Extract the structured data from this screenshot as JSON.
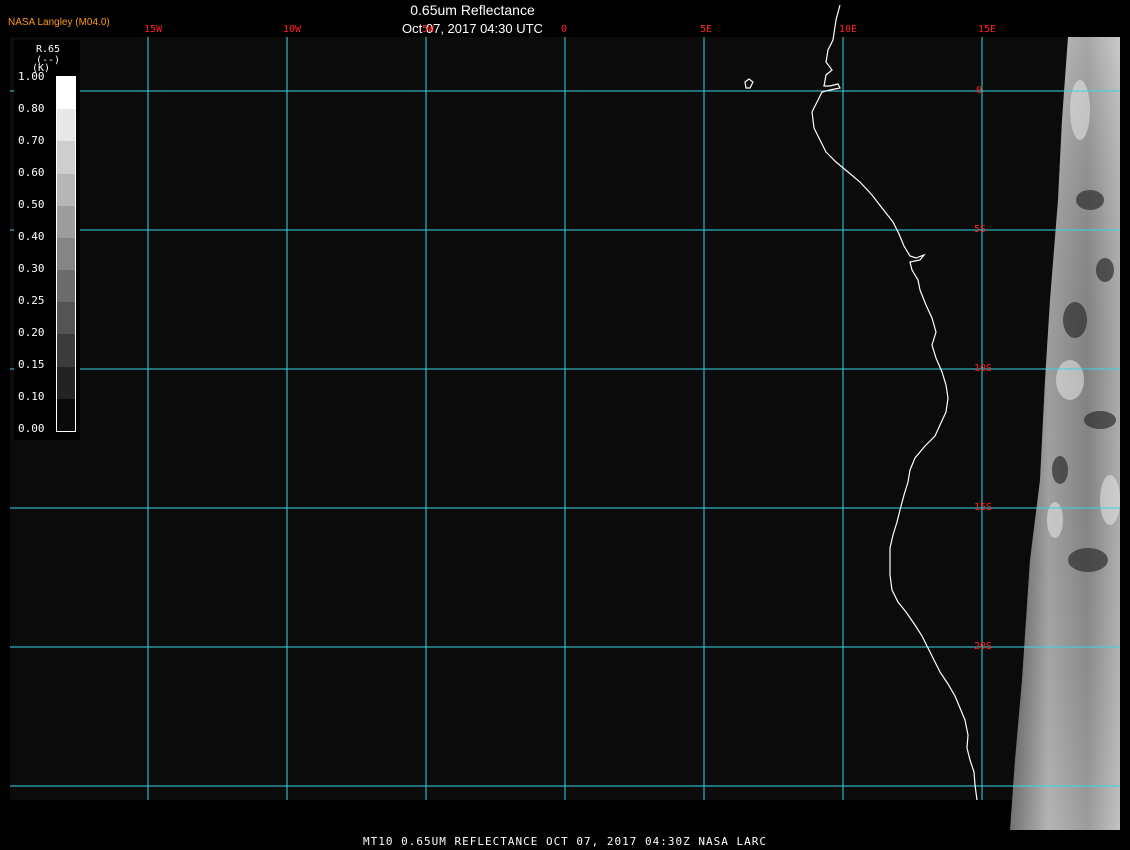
{
  "header": {
    "logo": "NASA Langley (M04.0)",
    "title": "0.65um Reflectance",
    "subtitle": "Oct 07, 2017 04:30 UTC"
  },
  "map": {
    "lon_labels": [
      "15W",
      "10W",
      "5W",
      "0",
      "5E",
      "10E",
      "15E"
    ],
    "lat_labels": [
      "0",
      "5S",
      "10S",
      "15S",
      "20S"
    ],
    "lon_range": [
      -20,
      15
    ],
    "lat_range": [
      1.5,
      -24
    ],
    "grid_color": "#35d6e6",
    "label_color": "#ff2020",
    "coast_color": "#ffffff"
  },
  "legend": {
    "title": "R.65",
    "unit": "(--)",
    "unit_alt": "(K)",
    "ticks": [
      "1.00",
      "0.80",
      "0.70",
      "0.60",
      "0.50",
      "0.40",
      "0.30",
      "0.25",
      "0.20",
      "0.15",
      "0.10",
      "0.00"
    ]
  },
  "footer": {
    "text": "MT10  0.65UM REFLECTANCE  OCT 07, 2017 04:30Z  NASA LARC"
  }
}
